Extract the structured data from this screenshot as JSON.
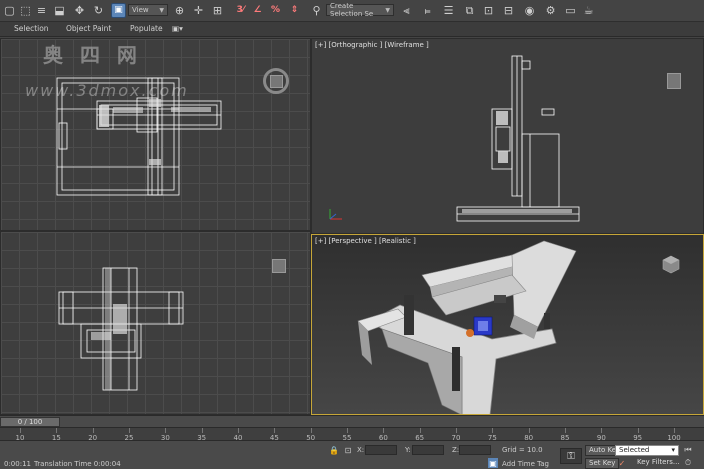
{
  "toolbar": {
    "view_dropdown": "View",
    "selection_set_dropdown": "Create Selection Se"
  },
  "ribbon": {
    "tabs": [
      "Selection",
      "Object Paint",
      "Populate"
    ]
  },
  "viewports": {
    "top_right": {
      "label": "[+] [Orthographic ] [Wireframe ]"
    },
    "bottom_right": {
      "label": "[+] [Perspective ] [Realistic ]"
    }
  },
  "watermark": {
    "text": "奥 四 网",
    "url": "www.3dmox.com"
  },
  "timeline": {
    "slider": "0 / 100",
    "ticks": [
      "10",
      "15",
      "20",
      "25",
      "30",
      "35",
      "40",
      "45",
      "50",
      "55",
      "60",
      "65",
      "70",
      "75",
      "80",
      "85",
      "90",
      "95",
      "100"
    ]
  },
  "status": {
    "clock": "0:00:11",
    "translation_time": "Translation Time  0:00:04",
    "x_label": "X:",
    "y_label": "Y:",
    "z_label": "Z:",
    "grid": "Grid = 10.0",
    "add_time_tag": "Add Time Tag",
    "auto_key": "Auto Key",
    "set_key": "Set Key",
    "selected": "Selected",
    "key_filters": "Key Filters..."
  },
  "colors": {
    "viewport_active_border": "#c6a638",
    "wire": "#ffffff",
    "model_blue": "#2a39c8",
    "model_orange": "#d4702a"
  },
  "icons": [
    "select-icon",
    "move-icon",
    "rotate-icon",
    "scale-icon",
    "snap-icon",
    "angle-snap-icon",
    "percent-snap-icon",
    "mirror-icon",
    "align-icon",
    "layer-icon",
    "render-setup-icon",
    "render-icon",
    "teapot-icon",
    "key-icon"
  ]
}
